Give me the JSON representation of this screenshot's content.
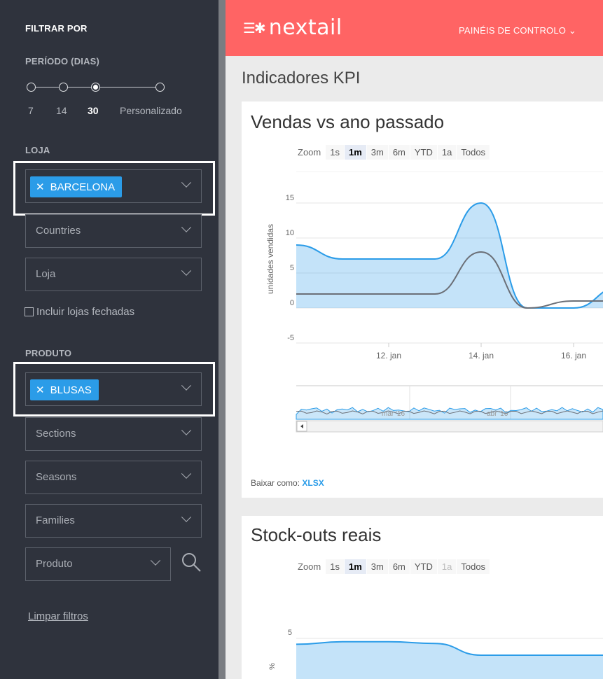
{
  "sidebar": {
    "title": "FILTRAR POR",
    "period": {
      "label": "PERÍODO (DIAS)",
      "options": [
        "7",
        "14",
        "30",
        "Personalizado"
      ],
      "selected": "30"
    },
    "store_section": "LOJA",
    "store_tag": "BARCELONA",
    "countries_placeholder": "Countries",
    "store_placeholder": "Loja",
    "include_closed": "Incluir lojas fechadas",
    "product_section": "PRODUTO",
    "product_tag": "BLUSAS",
    "sections_placeholder": "Sections",
    "seasons_placeholder": "Seasons",
    "families_placeholder": "Families",
    "product_placeholder": "Produto",
    "clear_filters": "Limpar filtros"
  },
  "header": {
    "logo": "nextail",
    "nav": "PAINÉIS DE CONTROLO"
  },
  "page_title": "Indicadores KPI",
  "colors": {
    "accent": "#ff6464",
    "sidebar": "#2f333d",
    "tag": "#2b9ce8",
    "series_current": "#2b9ce8",
    "series_last_year": "#6b6f77"
  },
  "icons": {
    "tag_remove": "close-icon",
    "dropdown": "chevron-down-icon",
    "search": "search-icon",
    "scroll_left": "arrow-left-icon"
  },
  "chart1": {
    "title": "Vendas vs ano passado",
    "zoom_label": "Zoom",
    "zoom_buttons": [
      "1s",
      "1m",
      "3m",
      "6m",
      "YTD",
      "1a",
      "Todos"
    ],
    "zoom_selected": "1m",
    "download_label": "Baixar como:",
    "download_format": "XLSX",
    "navigator_labels": [
      "mar '16",
      "abr '16"
    ]
  },
  "chart2": {
    "title": "Stock-outs reais",
    "zoom_label": "Zoom",
    "zoom_buttons": [
      "1s",
      "1m",
      "3m",
      "6m",
      "YTD",
      "1a",
      "Todos"
    ],
    "zoom_selected": "1m",
    "zoom_disabled": "1a"
  },
  "chart_data": [
    {
      "type": "area",
      "title": "Vendas vs ano passado",
      "ylabel": "unidades vendidas",
      "ylim": [
        -5,
        15
      ],
      "yticks": [
        -5,
        0,
        5,
        10,
        15
      ],
      "xticks": [
        "12. jan",
        "14. jan",
        "16. jan"
      ],
      "x": [
        "10. jan",
        "11. jan",
        "12. jan",
        "13. jan",
        "14. jan",
        "15. jan",
        "16. jan",
        "17. jan"
      ],
      "series": [
        {
          "values": [
            9,
            7,
            7,
            7,
            15,
            0,
            0,
            3
          ]
        },
        {
          "values": [
            2,
            2,
            2,
            2,
            8,
            0,
            1,
            1
          ]
        }
      ],
      "grid": true
    },
    {
      "type": "area",
      "title": "Stock-outs reais",
      "ylabel": "%",
      "ytick_labels": [
        "5"
      ],
      "x": [
        "10. jan",
        "11. jan",
        "12. jan",
        "13. jan",
        "14. jan",
        "15. jan",
        "16. jan",
        "17. jan"
      ],
      "series": [
        {
          "values": [
            4.3,
            4.6,
            4.6,
            4.4,
            3.0,
            3.0,
            3.0,
            3.0
          ]
        }
      ],
      "grid": true
    }
  ]
}
